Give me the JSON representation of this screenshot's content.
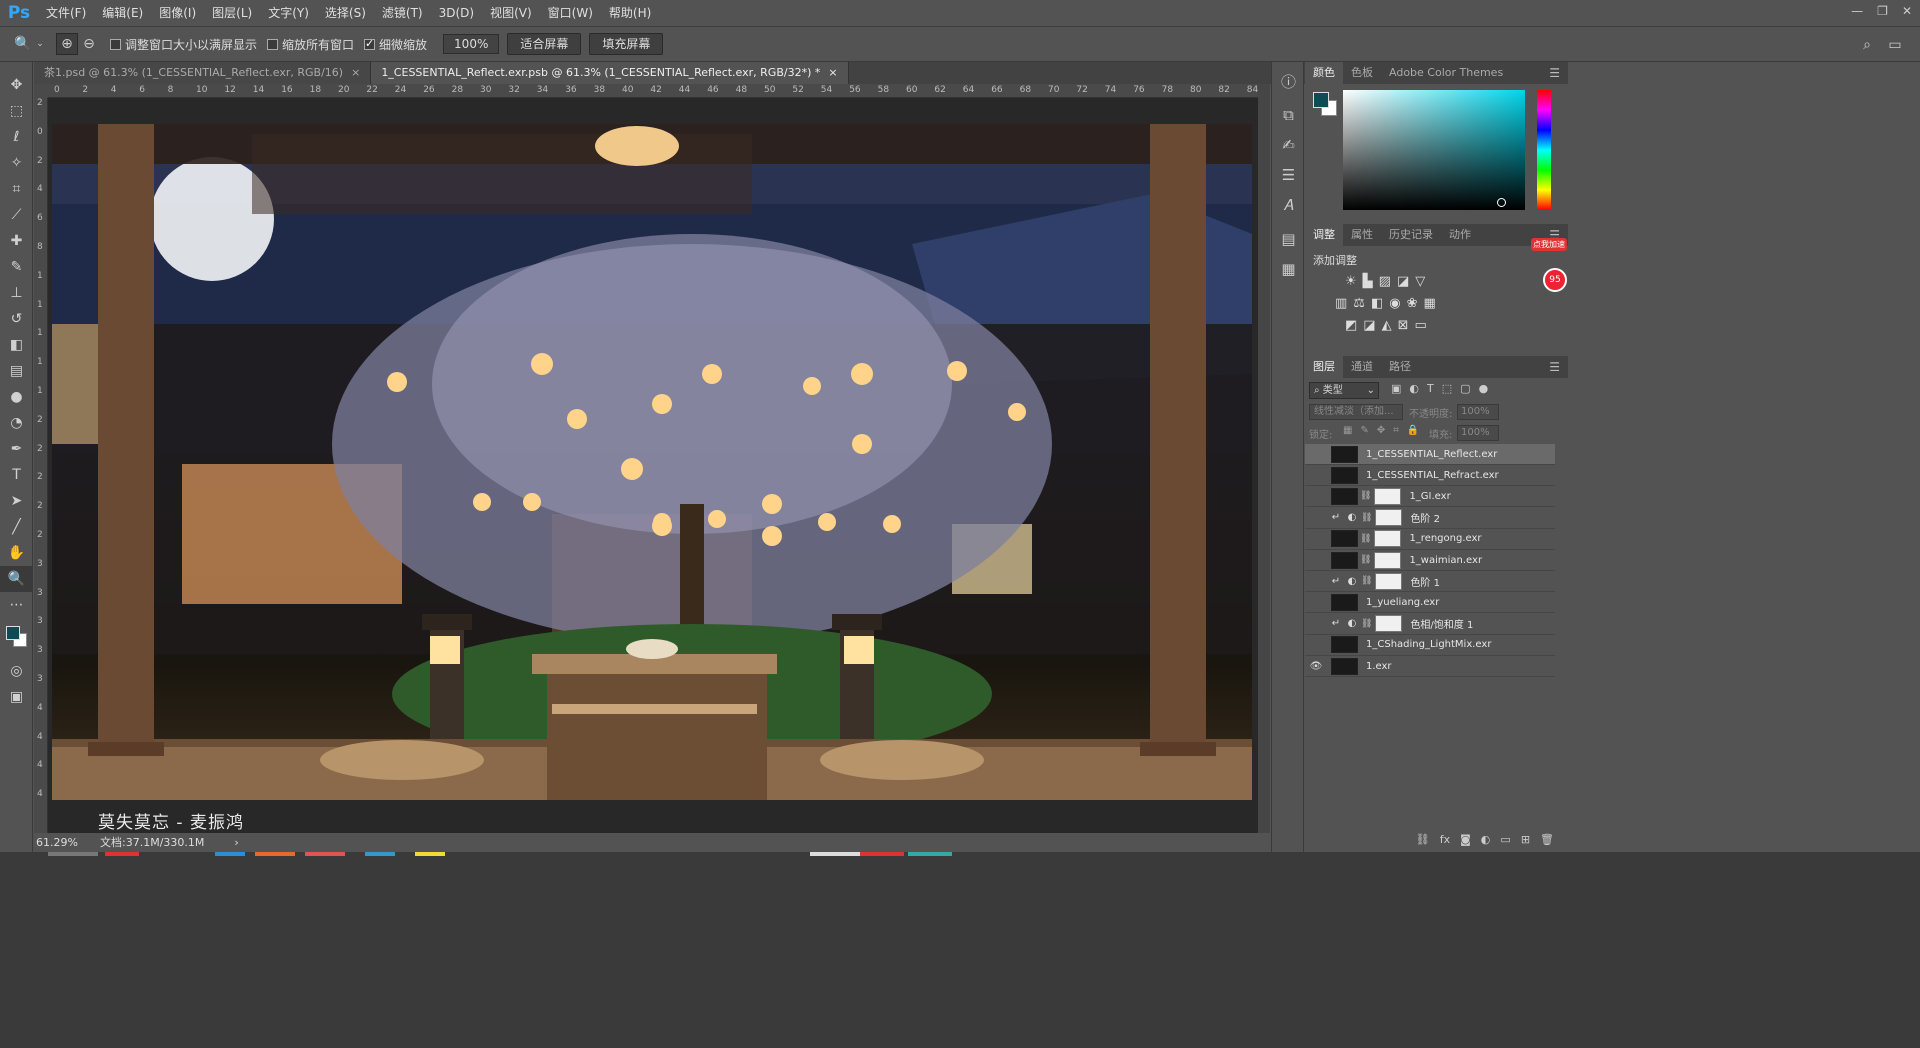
{
  "app": {
    "logo": "Ps"
  },
  "menu": [
    "文件(F)",
    "编辑(E)",
    "图像(I)",
    "图层(L)",
    "文字(Y)",
    "选择(S)",
    "滤镜(T)",
    "3D(D)",
    "视图(V)",
    "窗口(W)",
    "帮助(H)"
  ],
  "options": {
    "resize_windows": "调整窗口大小以满屏显示",
    "zoom_all": "缩放所有窗口",
    "scrubby_zoom": "细微缩放",
    "zoom_value": "100%",
    "fit_screen": "适合屏幕",
    "fill_screen": "填充屏幕"
  },
  "tabs": [
    {
      "label": "茶1.psd @ 61.3% (1_CESSENTIAL_Reflect.exr, RGB/16)",
      "active": false
    },
    {
      "label": "1_CESSENTIAL_Reflect.exr.psb @ 61.3% (1_CESSENTIAL_Reflect.exr, RGB/32*) *",
      "active": true
    }
  ],
  "ruler_top": [
    "0",
    "2",
    "4",
    "6",
    "8",
    "10",
    "12",
    "14",
    "16",
    "18",
    "20",
    "22",
    "24",
    "26",
    "28",
    "30",
    "32",
    "34",
    "36",
    "38",
    "40",
    "42",
    "44",
    "46",
    "48",
    "50",
    "52",
    "54",
    "56",
    "58",
    "60",
    "62",
    "64",
    "66",
    "68",
    "70",
    "72",
    "74",
    "76",
    "78",
    "80",
    "82",
    "84"
  ],
  "ruler_left": [
    "2",
    "0",
    "2",
    "4",
    "6",
    "8",
    "1",
    "1",
    "1",
    "1",
    "1",
    "2",
    "2",
    "2",
    "2",
    "2",
    "3",
    "3",
    "3",
    "3",
    "3",
    "4",
    "4",
    "4",
    "4"
  ],
  "canvas": {
    "caption": "莫失莫忘 - 麦振鸿"
  },
  "status": {
    "zoom": "61.29%",
    "doc": "文档:37.1M/330.1M",
    "arrow": "›"
  },
  "color_panel": {
    "tabs": [
      "颜色",
      "色板",
      "Adobe Color Themes"
    ],
    "fg_color": "#0e4b55",
    "bg_color": "#ffffff"
  },
  "adjust_panel": {
    "tabs": [
      "调整",
      "属性",
      "历史记录",
      "动作"
    ],
    "heading": "添加调整"
  },
  "layers_panel": {
    "tabs": [
      "图层",
      "通道",
      "路径"
    ],
    "filter_label": "类型",
    "blend_mode": "线性减淡（添加...",
    "opacity_label": "不透明度:",
    "opacity_value": "100%",
    "lock_label": "锁定:",
    "fill_label": "填充:",
    "fill_value": "100%",
    "layers": [
      {
        "name": "1_CESSENTIAL_Reflect.exr",
        "visible": false,
        "selected": true,
        "mask": false,
        "adjust": false
      },
      {
        "name": "1_CESSENTIAL_Refract.exr",
        "visible": false,
        "selected": false,
        "mask": false,
        "adjust": false
      },
      {
        "name": "1_GI.exr",
        "visible": false,
        "selected": false,
        "mask": true,
        "adjust": false
      },
      {
        "name": "色阶 2",
        "visible": false,
        "selected": false,
        "mask": true,
        "adjust": true
      },
      {
        "name": "1_rengong.exr",
        "visible": false,
        "selected": false,
        "mask": true,
        "adjust": false
      },
      {
        "name": "1_waimian.exr",
        "visible": false,
        "selected": false,
        "mask": true,
        "adjust": false
      },
      {
        "name": "色阶 1",
        "visible": false,
        "selected": false,
        "mask": true,
        "adjust": true
      },
      {
        "name": "1_yueliang.exr",
        "visible": false,
        "selected": false,
        "mask": false,
        "adjust": false
      },
      {
        "name": "色相/饱和度 1",
        "visible": false,
        "selected": false,
        "mask": true,
        "adjust": true
      },
      {
        "name": "1_CShading_LightMix.exr",
        "visible": false,
        "selected": false,
        "mask": false,
        "adjust": false
      },
      {
        "name": "1.exr",
        "visible": true,
        "selected": false,
        "mask": false,
        "adjust": false
      }
    ]
  },
  "badge": {
    "promo": "点我加速",
    "number": "95"
  }
}
